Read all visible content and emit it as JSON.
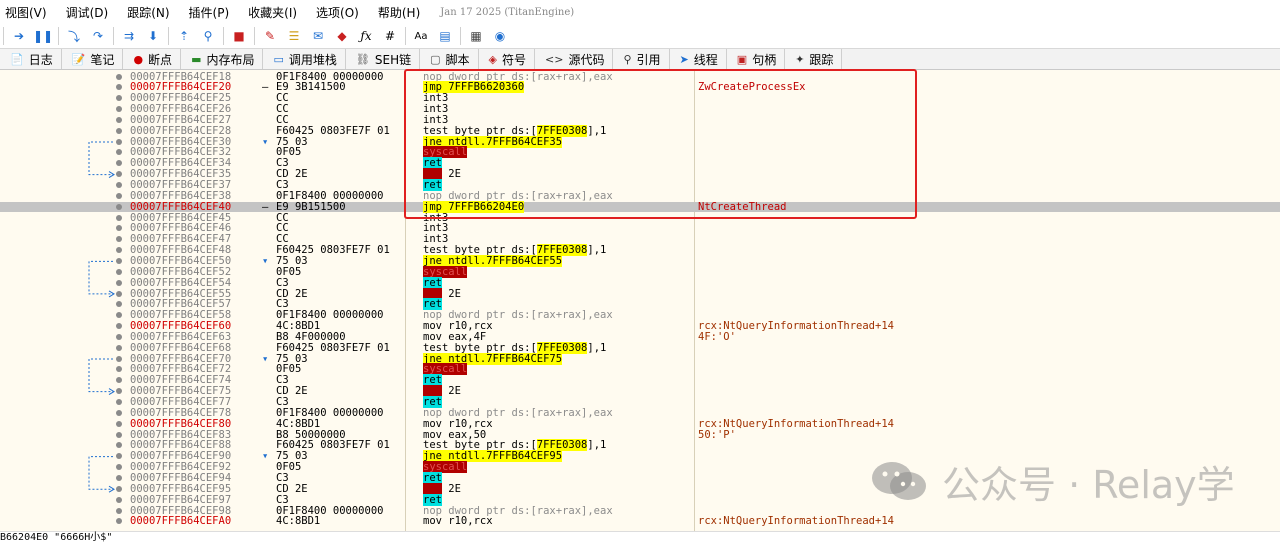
{
  "menu": [
    {
      "label": "视图(V)"
    },
    {
      "label": "调试(D)"
    },
    {
      "label": "跟踪(N)"
    },
    {
      "label": "插件(P)"
    },
    {
      "label": "收藏夹(I)"
    },
    {
      "label": "选项(O)"
    },
    {
      "label": "帮助(H)"
    }
  ],
  "build_info": "Jan 17 2025 (TitanEngine)",
  "tabs": [
    {
      "label": "日志",
      "icon": "log-icon"
    },
    {
      "label": "笔记",
      "icon": "notes-icon"
    },
    {
      "label": "断点",
      "icon": "breakpoint-icon"
    },
    {
      "label": "内存布局",
      "icon": "memory-map-icon"
    },
    {
      "label": "调用堆栈",
      "icon": "call-stack-icon"
    },
    {
      "label": "SEH链",
      "icon": "seh-chain-icon"
    },
    {
      "label": "脚本",
      "icon": "script-icon"
    },
    {
      "label": "符号",
      "icon": "symbols-icon"
    },
    {
      "label": "源代码",
      "icon": "source-icon"
    },
    {
      "label": "引用",
      "icon": "references-icon"
    },
    {
      "label": "线程",
      "icon": "threads-icon"
    },
    {
      "label": "句柄",
      "icon": "handles-icon"
    },
    {
      "label": "跟踪",
      "icon": "trace-icon"
    }
  ],
  "disasm": [
    {
      "addr": "00007FFFB64CEF18",
      "bytes": "0F1F8400 00000000",
      "instr": "nop dword ptr ds:[rax+rax],eax",
      "type": "nop"
    },
    {
      "addr": "00007FFFB64CEF20",
      "bytes": "E9 3B141500",
      "instr": "jmp 7FFFB6620360",
      "type": "jmp",
      "hl": true,
      "dash": "-",
      "comment": "ZwCreateProcessEx"
    },
    {
      "addr": "00007FFFB64CEF25",
      "bytes": "CC",
      "instr": "int3",
      "type": "plain"
    },
    {
      "addr": "00007FFFB64CEF26",
      "bytes": "CC",
      "instr": "int3",
      "type": "plain"
    },
    {
      "addr": "00007FFFB64CEF27",
      "bytes": "CC",
      "instr": "int3",
      "type": "plain"
    },
    {
      "addr": "00007FFFB64CEF28",
      "bytes": "F60425 0803FE7F 01",
      "instr": "test byte ptr ds:[7FFE0308],1",
      "type": "test"
    },
    {
      "addr": "00007FFFB64CEF30",
      "bytes": "75 03",
      "instr": "jne ntdll.7FFFB64CEF35",
      "type": "jne",
      "dash": "v"
    },
    {
      "addr": "00007FFFB64CEF32",
      "bytes": "0F05",
      "instr": "syscall",
      "type": "syscall"
    },
    {
      "addr": "00007FFFB64CEF34",
      "bytes": "C3",
      "instr": "ret",
      "type": "ret"
    },
    {
      "addr": "00007FFFB64CEF35",
      "bytes": "CD 2E",
      "instr": "int 2E",
      "type": "int2e",
      "arrow": "jmp-target"
    },
    {
      "addr": "00007FFFB64CEF37",
      "bytes": "C3",
      "instr": "ret",
      "type": "ret"
    },
    {
      "addr": "00007FFFB64CEF38",
      "bytes": "0F1F8400 00000000",
      "instr": "nop dword ptr ds:[rax+rax],eax",
      "type": "nop"
    },
    {
      "addr": "00007FFFB64CEF40",
      "bytes": "E9 9B151500",
      "instr": "jmp 7FFFB66204E0",
      "type": "jmp",
      "hl": true,
      "dash": "-",
      "comment": "NtCreateThread",
      "selected": true
    },
    {
      "addr": "00007FFFB64CEF45",
      "bytes": "CC",
      "instr": "int3",
      "type": "plain"
    },
    {
      "addr": "00007FFFB64CEF46",
      "bytes": "CC",
      "instr": "int3",
      "type": "plain"
    },
    {
      "addr": "00007FFFB64CEF47",
      "bytes": "CC",
      "instr": "int3",
      "type": "plain"
    },
    {
      "addr": "00007FFFB64CEF48",
      "bytes": "F60425 0803FE7F 01",
      "instr": "test byte ptr ds:[7FFE0308],1",
      "type": "test"
    },
    {
      "addr": "00007FFFB64CEF50",
      "bytes": "75 03",
      "instr": "jne ntdll.7FFFB64CEF55",
      "type": "jne",
      "dash": "v"
    },
    {
      "addr": "00007FFFB64CEF52",
      "bytes": "0F05",
      "instr": "syscall",
      "type": "syscall"
    },
    {
      "addr": "00007FFFB64CEF54",
      "bytes": "C3",
      "instr": "ret",
      "type": "ret"
    },
    {
      "addr": "00007FFFB64CEF55",
      "bytes": "CD 2E",
      "instr": "int 2E",
      "type": "int2e",
      "arrow": "jmp-target"
    },
    {
      "addr": "00007FFFB64CEF57",
      "bytes": "C3",
      "instr": "ret",
      "type": "ret"
    },
    {
      "addr": "00007FFFB64CEF58",
      "bytes": "0F1F8400 00000000",
      "instr": "nop dword ptr ds:[rax+rax],eax",
      "type": "nop"
    },
    {
      "addr": "00007FFFB64CEF60",
      "bytes": "4C:8BD1",
      "instr": "mov r10,rcx",
      "type": "plain",
      "hl": true,
      "comment": "rcx:NtQueryInformationThread+14"
    },
    {
      "addr": "00007FFFB64CEF63",
      "bytes": "B8 4F000000",
      "instr": "mov eax,4F",
      "type": "plain",
      "comment": "4F:'O'"
    },
    {
      "addr": "00007FFFB64CEF68",
      "bytes": "F60425 0803FE7F 01",
      "instr": "test byte ptr ds:[7FFE0308],1",
      "type": "test"
    },
    {
      "addr": "00007FFFB64CEF70",
      "bytes": "75 03",
      "instr": "jne ntdll.7FFFB64CEF75",
      "type": "jne",
      "dash": "v"
    },
    {
      "addr": "00007FFFB64CEF72",
      "bytes": "0F05",
      "instr": "syscall",
      "type": "syscall"
    },
    {
      "addr": "00007FFFB64CEF74",
      "bytes": "C3",
      "instr": "ret",
      "type": "ret"
    },
    {
      "addr": "00007FFFB64CEF75",
      "bytes": "CD 2E",
      "instr": "int 2E",
      "type": "int2e",
      "arrow": "jmp-target"
    },
    {
      "addr": "00007FFFB64CEF77",
      "bytes": "C3",
      "instr": "ret",
      "type": "ret"
    },
    {
      "addr": "00007FFFB64CEF78",
      "bytes": "0F1F8400 00000000",
      "instr": "nop dword ptr ds:[rax+rax],eax",
      "type": "nop"
    },
    {
      "addr": "00007FFFB64CEF80",
      "bytes": "4C:8BD1",
      "instr": "mov r10,rcx",
      "type": "plain",
      "hl": true,
      "comment": "rcx:NtQueryInformationThread+14"
    },
    {
      "addr": "00007FFFB64CEF83",
      "bytes": "B8 50000000",
      "instr": "mov eax,50",
      "type": "plain",
      "comment": "50:'P'"
    },
    {
      "addr": "00007FFFB64CEF88",
      "bytes": "F60425 0803FE7F 01",
      "instr": "test byte ptr ds:[7FFE0308],1",
      "type": "test"
    },
    {
      "addr": "00007FFFB64CEF90",
      "bytes": "75 03",
      "instr": "jne ntdll.7FFFB64CEF95",
      "type": "jne",
      "dash": "v"
    },
    {
      "addr": "00007FFFB64CEF92",
      "bytes": "0F05",
      "instr": "syscall",
      "type": "syscall"
    },
    {
      "addr": "00007FFFB64CEF94",
      "bytes": "C3",
      "instr": "ret",
      "type": "ret"
    },
    {
      "addr": "00007FFFB64CEF95",
      "bytes": "CD 2E",
      "instr": "int 2E",
      "type": "int2e",
      "arrow": "jmp-target"
    },
    {
      "addr": "00007FFFB64CEF97",
      "bytes": "C3",
      "instr": "ret",
      "type": "ret"
    },
    {
      "addr": "00007FFFB64CEF98",
      "bytes": "0F1F8400 00000000",
      "instr": "nop dword ptr ds:[rax+rax],eax",
      "type": "nop"
    },
    {
      "addr": "00007FFFB64CEFA0",
      "bytes": "4C:8BD1",
      "instr": "mov r10,rcx",
      "type": "plain",
      "hl": true,
      "comment": "rcx:NtQueryInformationThread+14"
    }
  ],
  "status": "B66204E0 \"6666H小$\"",
  "watermark": "公众号 · Relay学",
  "colors": {
    "background": "#fffbf0",
    "address_highlight": "#d00000",
    "jump_highlight": "#ffff00",
    "syscall_bg": "#b00000",
    "ret_bg": "#00e0e0",
    "comment": "#a03000",
    "annotation_box": "#e02020"
  }
}
